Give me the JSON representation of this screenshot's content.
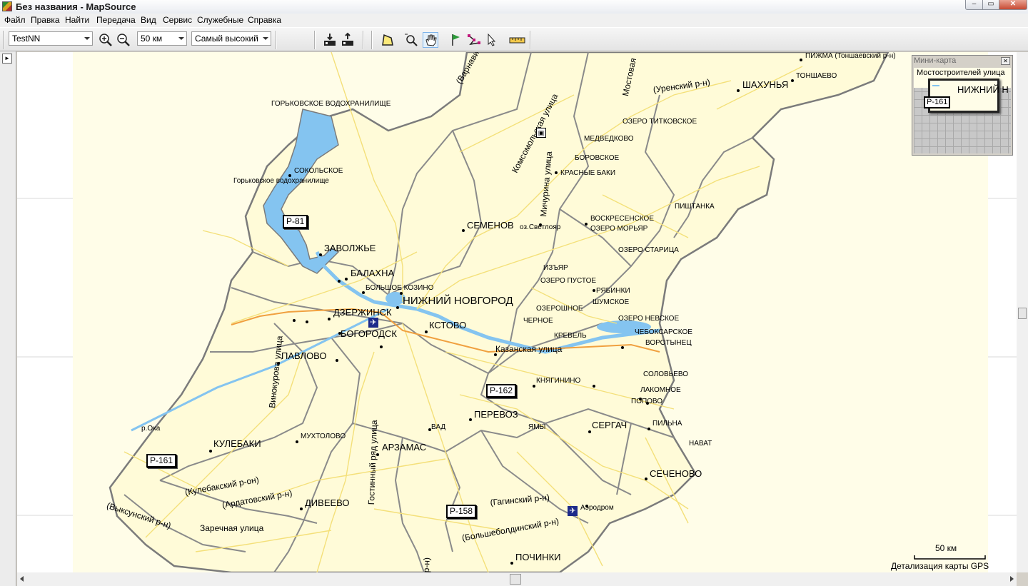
{
  "window": {
    "title": "Без названия - MapSource",
    "controls": {
      "minimize": "‒",
      "maximize": "▭",
      "close": "✕"
    }
  },
  "menu": [
    "Файл",
    "Правка",
    "Найти",
    "Передача",
    "Вид",
    "Сервис",
    "Служебные",
    "Справка"
  ],
  "toolbar": {
    "map_product": "TestNN",
    "zoom_scale": "50 км",
    "detail_level": "Самый высокий",
    "tools": [
      "zoom-in-icon",
      "zoom-out-icon",
      "receive-from-device-icon",
      "send-to-device-icon",
      "selection-tool-icon",
      "zoom-tool-icon",
      "hand-tool-icon",
      "waypoint-tool-icon",
      "route-tool-icon",
      "pointer-tool-icon",
      "measure-tool-icon"
    ],
    "active_tool": "hand-tool-icon"
  },
  "minimap": {
    "title": "Мини-карта",
    "close": "✕",
    "street_label": "Мостостроителей улица",
    "city_label": "НИЖНИЙ Н",
    "road_label": "P-161"
  },
  "map": {
    "colors": {
      "land": "#fffde8",
      "water": "#84c4f0",
      "border": "#7b7b7b",
      "road": "#f7e58a",
      "highway": "#f0a040"
    },
    "cities_major": [
      {
        "name": "НИЖНИЙ НОВГОРОД"
      },
      {
        "name": "ДЗЕРЖИНСК"
      },
      {
        "name": "БОГОРОДСК"
      },
      {
        "name": "КСТОВО"
      },
      {
        "name": "ЗАВОЛЖЬЕ"
      },
      {
        "name": "БАЛАХНА"
      },
      {
        "name": "СЕМЕНОВ"
      },
      {
        "name": "ПАВЛОВО"
      },
      {
        "name": "АРЗАМАС"
      },
      {
        "name": "ПЕРЕВОЗ"
      },
      {
        "name": "СЕРГАЧ"
      },
      {
        "name": "КУЛЕБАКИ"
      },
      {
        "name": "ДИВЕЕВО"
      },
      {
        "name": "СЕЧЕНОВО"
      },
      {
        "name": "ПОЧИНКИ"
      },
      {
        "name": "ШАХУНЬЯ"
      }
    ],
    "places_minor": [
      "ПИЖМА (Тоншаевский р-н)",
      "ТОНШАЕВО",
      "ГОРЬКОВСКОЕ ВОДОХРАНИЛИЩЕ",
      "СОКОЛЬСКОЕ",
      "Горьковское водохранилище",
      "ОЗЕРО ТИТКОВСКОЕ",
      "МЕДВЕДКОВО",
      "БОРОВСКОЕ",
      "КРАСНЫЕ БАКИ",
      "ПИШТАНКА",
      "ВОСКРЕСЕНСКОЕ",
      "ОЗЕРО МОРЬЯР",
      "оз.Светлояр",
      "ОЗЕРО СТАРИЦА",
      "ИЗЪЯР",
      "ОЗЕРО ПУСТОЕ",
      "РЯБИНКИ",
      "ШУМСКОЕ",
      "ОЗЕРОШНОЕ",
      "ЧЕРНОЕ",
      "ОЗЕРО НЕВСКОЕ",
      "ЧЕБОКСАРСКОЕ",
      "КРЕВЕЛЬ",
      "ВОРОТЫНЕЦ",
      "БОЛЬШОЕ КОЗИНО",
      "СОЛОВЬЕВО",
      "КНЯГИНИНО",
      "ЛАКОМНОЕ",
      "ПОПОВО",
      "ПИЛЬНА",
      "ВАД",
      "ЯМЫ",
      "НАВАТ",
      "МУХТОЛОВО",
      "р.Ока",
      "Аэродром"
    ],
    "streets": [
      "(Варнавинский р-н)",
      "Мостовая",
      "(Уренский р-н)",
      "Комсомольская улица",
      "Мичурина улица",
      "Казанская улица",
      "Винокурова улица",
      "Гостинный ряд улица",
      "(Кулебакский р-он)",
      "(Ардатовский р-н)",
      "(Выксунский р-н)",
      "Заречная улица",
      "(Гагинский р-н)",
      "(Большеболдинский р-н)",
      "р-н)"
    ],
    "road_shields": [
      "P-81",
      "P-162",
      "P-161",
      "P-158"
    ],
    "scale_bar": "50 км",
    "detail_note": "Детализация карты GPS"
  }
}
